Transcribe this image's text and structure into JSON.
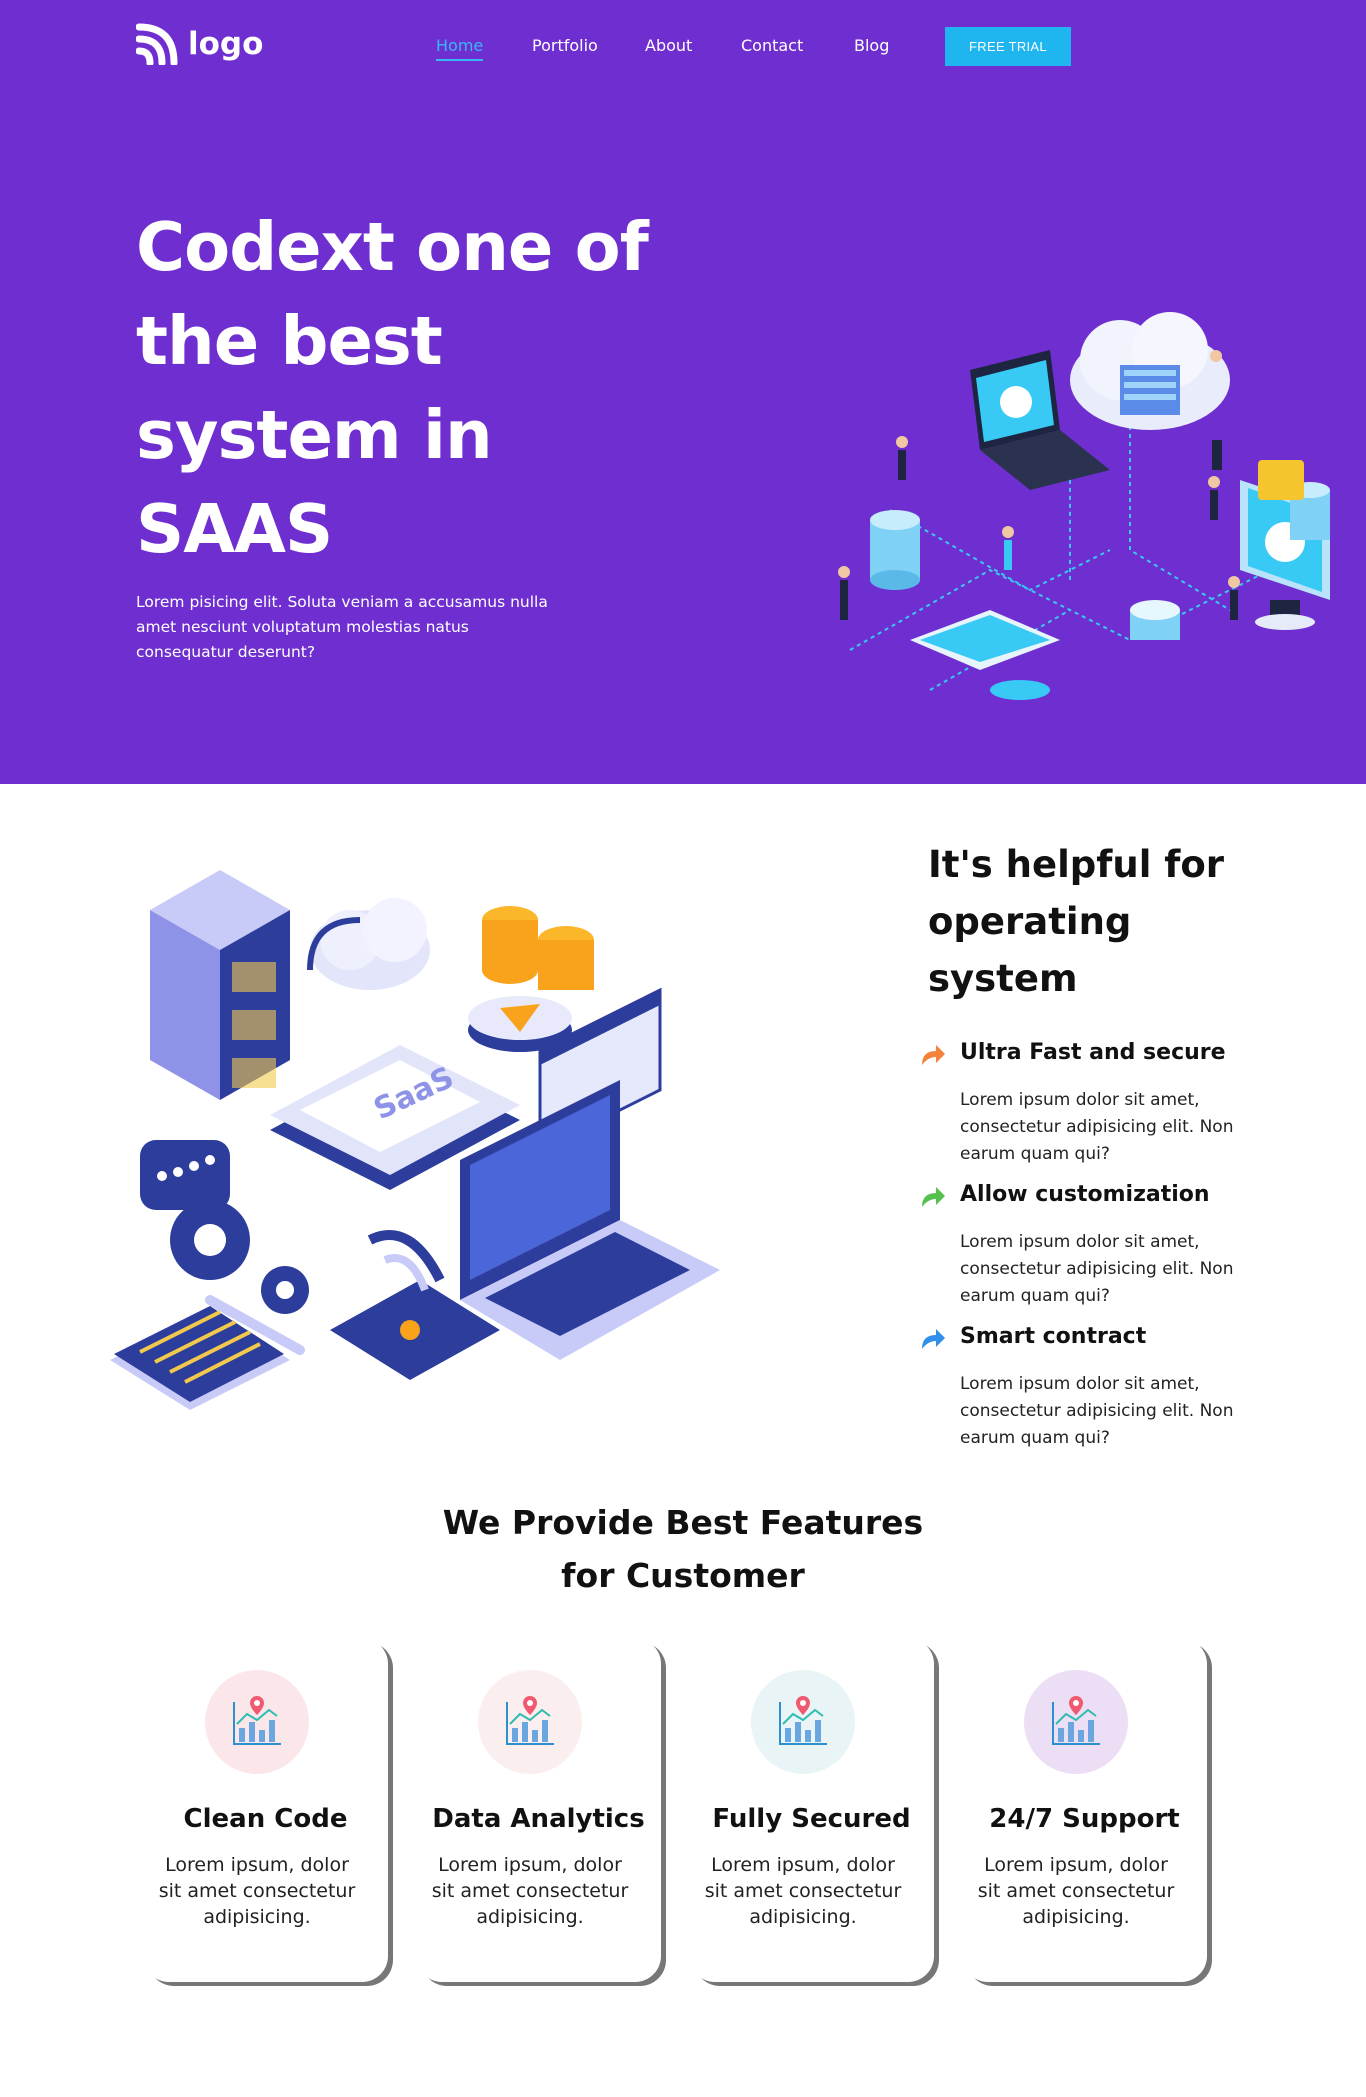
{
  "header": {
    "logo_text": "logo",
    "nav": [
      {
        "label": "Home",
        "active": true
      },
      {
        "label": "Portfolio",
        "active": false
      },
      {
        "label": "About",
        "active": false
      },
      {
        "label": "Contact",
        "active": false
      },
      {
        "label": "Blog",
        "active": false
      }
    ],
    "trial_button": "FREE TRIAL"
  },
  "hero": {
    "title_lines": [
      "Codext one of",
      "the best",
      "system in",
      "SAAS"
    ],
    "description": "Lorem pisicing elit. Soluta veniam a accusamus nulla amet nesciunt voluptatum molestias natus consequatur deserunt?"
  },
  "features_intro": {
    "title_lines": [
      "It's helpful for",
      "operating",
      "system"
    ],
    "items": [
      {
        "title": "Ultra Fast and secure",
        "desc": "Lorem ipsum dolor sit amet, consectetur adipisicing elit. Non earum quam qui?",
        "arrow_color": "#f5813b",
        "icon": "share-arrow-icon"
      },
      {
        "title": "Allow customization",
        "desc": "Lorem ipsum dolor sit amet, consectetur adipisicing elit. Non earum quam qui?",
        "arrow_color": "#56c04c",
        "icon": "share-arrow-icon"
      },
      {
        "title": "Smart contract",
        "desc": "Lorem ipsum dolor sit amet, consectetur adipisicing elit. Non earum quam qui?",
        "arrow_color": "#2f8fea",
        "icon": "share-arrow-icon"
      }
    ]
  },
  "best_features": {
    "title_lines": [
      "We Provide Best Features",
      "for Customer"
    ],
    "cards": [
      {
        "title": "Clean Code",
        "desc": "Lorem ipsum, dolor sit amet consectetur adipisicing.",
        "icon_bg": "#fbe7e9",
        "icon": "analytics-chart-icon"
      },
      {
        "title": "Data Analytics",
        "desc": "Lorem ipsum, dolor sit amet consectetur adipisicing.",
        "icon_bg": "#fbeeee",
        "icon": "analytics-chart-icon"
      },
      {
        "title": "Fully Secured",
        "desc": "Lorem ipsum, dolor sit amet consectetur adipisicing.",
        "icon_bg": "#e8f4f5",
        "icon": "analytics-chart-icon"
      },
      {
        "title": "24/7 Support",
        "desc": "Lorem ipsum, dolor sit amet consectetur adipisicing.",
        "icon_bg": "#ecdff5",
        "icon": "analytics-chart-icon"
      }
    ]
  },
  "colors": {
    "hero_bg": "#6f2fd0",
    "accent": "#1fb6ef",
    "nav_active": "#37b8f5"
  }
}
